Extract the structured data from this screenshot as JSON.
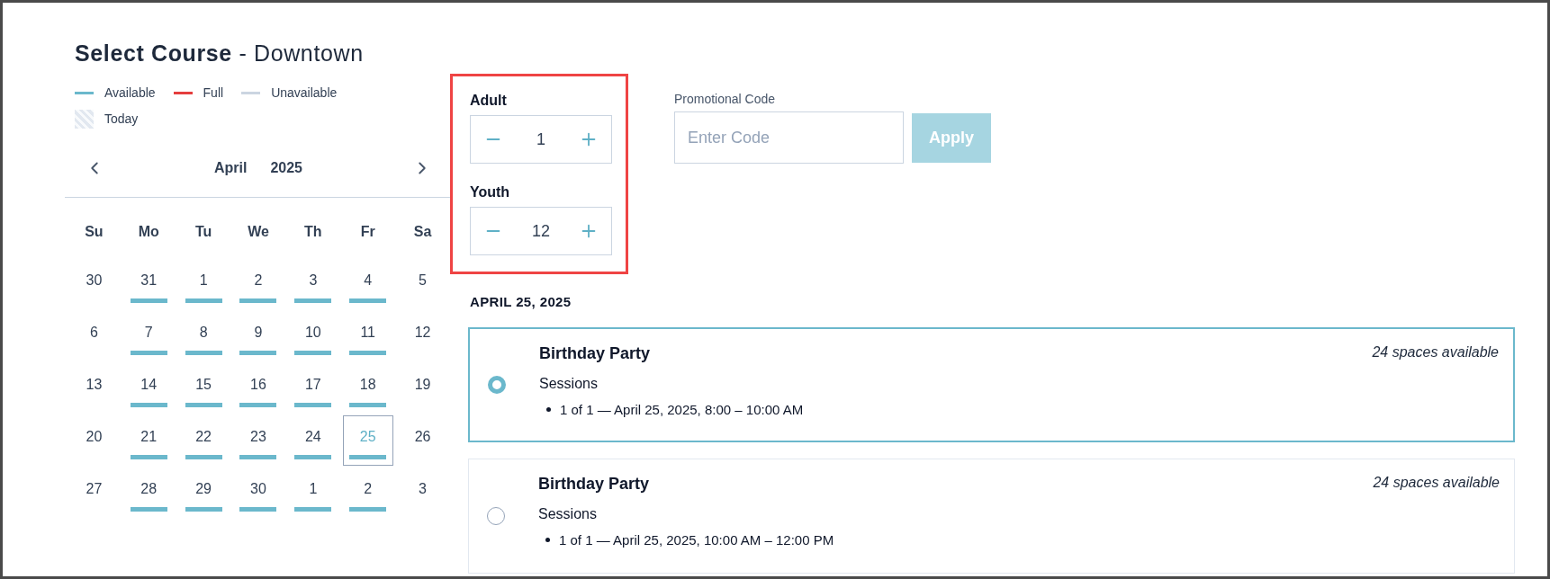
{
  "title": "**Select Course** - Downtown",
  "legend": [
    {
      "kind": "line",
      "label": "Available",
      "color": "#6bb8cc"
    },
    {
      "kind": "line",
      "label": "Full",
      "color": "#e53e3e"
    },
    {
      "kind": "line",
      "label": "Unavailable",
      "color": "#cbd5e1"
    },
    {
      "kind": "pattern",
      "label": "Today"
    }
  ],
  "calendar": {
    "month": "April",
    "year": "2025",
    "weekdays": [
      "Su",
      "Mo",
      "Tu",
      "We",
      "Th",
      "Fr",
      "Sa"
    ],
    "days": [
      {
        "number": "30",
        "available": false,
        "selected": false
      },
      {
        "number": "31",
        "available": true,
        "selected": false
      },
      {
        "number": "1",
        "available": true,
        "selected": false
      },
      {
        "number": "2",
        "available": true,
        "selected": false
      },
      {
        "number": "3",
        "available": true,
        "selected": false
      },
      {
        "number": "4",
        "available": true,
        "selected": false
      },
      {
        "number": "5",
        "available": false,
        "selected": false
      },
      {
        "number": "6",
        "available": false,
        "selected": false
      },
      {
        "number": "7",
        "available": true,
        "selected": false
      },
      {
        "number": "8",
        "available": true,
        "selected": false
      },
      {
        "number": "9",
        "available": true,
        "selected": false
      },
      {
        "number": "10",
        "available": true,
        "selected": false
      },
      {
        "number": "11",
        "available": true,
        "selected": false
      },
      {
        "number": "12",
        "available": false,
        "selected": false
      },
      {
        "number": "13",
        "available": false,
        "selected": false
      },
      {
        "number": "14",
        "available": true,
        "selected": false
      },
      {
        "number": "15",
        "available": true,
        "selected": false
      },
      {
        "number": "16",
        "available": true,
        "selected": false
      },
      {
        "number": "17",
        "available": true,
        "selected": false
      },
      {
        "number": "18",
        "available": true,
        "selected": false
      },
      {
        "number": "19",
        "available": false,
        "selected": false
      },
      {
        "number": "20",
        "available": false,
        "selected": false
      },
      {
        "number": "21",
        "available": true,
        "selected": false
      },
      {
        "number": "22",
        "available": true,
        "selected": false
      },
      {
        "number": "23",
        "available": true,
        "selected": false
      },
      {
        "number": "24",
        "available": true,
        "selected": false
      },
      {
        "number": "25",
        "available": true,
        "selected": true
      },
      {
        "number": "26",
        "available": false,
        "selected": false
      },
      {
        "number": "27",
        "available": false,
        "selected": false
      },
      {
        "number": "28",
        "available": true,
        "selected": false
      },
      {
        "number": "29",
        "available": true,
        "selected": false
      },
      {
        "number": "30",
        "available": true,
        "selected": false
      },
      {
        "number": "1",
        "available": true,
        "selected": false
      },
      {
        "number": "2",
        "available": true,
        "selected": false
      },
      {
        "number": "3",
        "available": false,
        "selected": false
      }
    ]
  },
  "quantities": [
    {
      "label": "Adult",
      "value": "1"
    },
    {
      "label": "Youth",
      "value": "12"
    }
  ],
  "promo": {
    "label": "Promotional Code",
    "placeholder": "Enter Code",
    "button": "Apply"
  },
  "date_heading": "APRIL 25, 2025",
  "courses": [
    {
      "name": "Birthday Party",
      "spaces": "24 spaces available",
      "sessions_label": "Sessions",
      "sessions": [
        "1 of 1 — April 25, 2025, 8:00 – 10:00 AM"
      ],
      "selected": true
    },
    {
      "name": "Birthday Party",
      "spaces": "24 spaces available",
      "sessions_label": "Sessions",
      "sessions": [
        "1 of 1 — April 25, 2025, 10:00 AM – 12:00 PM"
      ],
      "selected": false
    }
  ]
}
